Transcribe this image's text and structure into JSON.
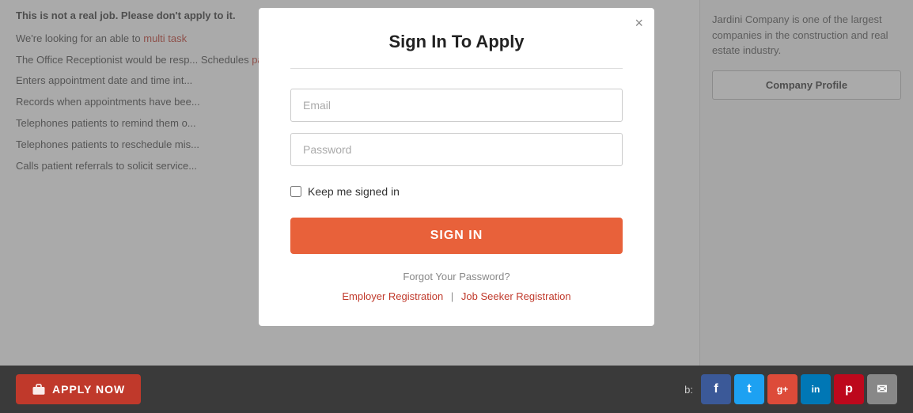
{
  "background": {
    "warning": "This is not a real job. Please don't apply to it.",
    "intro": "We're looking for an able to multi task",
    "lines": [
      "The Office Receptionist would be resp... Schedules patient appointments.",
      "Enters appointment date and time int...",
      "Records when appointments have bee...",
      "Telephones patients to remind them o...",
      "Telephones patients to reschedule mis...",
      "Calls patient referrals to solicit service..."
    ]
  },
  "sidebar": {
    "description": "Jardini Company is one of the largest companies in the construction and real estate industry.",
    "company_profile_label": "Company Profile"
  },
  "bottom_bar": {
    "apply_now_label": "APPLY NOW",
    "share_label": "b:",
    "social": [
      {
        "name": "facebook",
        "letter": "f",
        "class": "fb"
      },
      {
        "name": "twitter",
        "letter": "t",
        "class": "tw"
      },
      {
        "name": "google-plus",
        "letter": "g+",
        "class": "gp"
      },
      {
        "name": "linkedin",
        "letter": "in",
        "class": "li"
      },
      {
        "name": "pinterest",
        "letter": "p",
        "class": "pi"
      },
      {
        "name": "email",
        "letter": "✉",
        "class": "em"
      }
    ]
  },
  "modal": {
    "title": "Sign In To Apply",
    "close_label": "×",
    "email_placeholder": "Email",
    "password_placeholder": "Password",
    "keep_signed_label": "Keep me signed in",
    "sign_in_label": "SIGN IN",
    "forgot_password_label": "Forgot Your Password?",
    "employer_registration_label": "Employer Registration",
    "job_seeker_registration_label": "Job Seeker Registration",
    "divider": "|"
  }
}
